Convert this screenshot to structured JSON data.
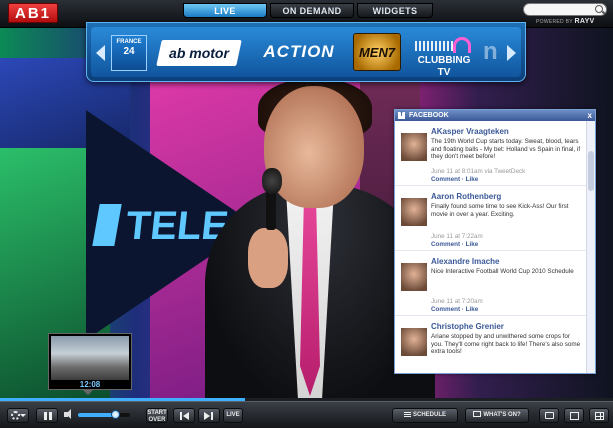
{
  "brand": {
    "logo_text": "AB1",
    "powered_by_prefix": "POWERED BY",
    "powered_by_name": "RAYV"
  },
  "tabs": [
    {
      "label": "LIVE",
      "active": true
    },
    {
      "label": "ON DEMAND",
      "active": false
    },
    {
      "label": "WIDGETS",
      "active": false
    }
  ],
  "search": {
    "placeholder": ""
  },
  "channels": [
    {
      "name": "FRANCE 24",
      "logo_top": "FRANCE",
      "logo_bottom": "24"
    },
    {
      "name": "AB1 MOTOR",
      "logo_text": "ab motor"
    },
    {
      "name": "ACTION",
      "logo_text": "ACTION"
    },
    {
      "name": "MEN7",
      "logo_text": "MEN7"
    },
    {
      "name": "CLUBBING TV",
      "logo_text": "CLUBBING TV"
    },
    {
      "name": "n",
      "logo_text": "n"
    }
  ],
  "video": {
    "channel_overlay_text": "TELE",
    "channel_overlay_number": "i"
  },
  "facebook": {
    "title": "FACEBOOK",
    "close": "x",
    "posts": [
      {
        "author": "AKasper Vraagteken",
        "text": "The 19th World Cup starts today. Sweat, blood, tears and floating balls - My bet: Holland vs Spain in final, if they don't meet before!",
        "time": "June 11 at 8:01am via TweetDeck",
        "actions": "Comment · Like"
      },
      {
        "author": "Aaron Rothenberg",
        "text": "Finally found some time to see Kick-Ass! Our first movie in over a year. Exciting.",
        "time": "June 11 at 7:22am",
        "actions": "Comment · Like"
      },
      {
        "author": "Alexandre Imache",
        "text": "Nice Interactive Football World Cup 2010 Schedule",
        "time": "June 11 at 7:20am",
        "actions": "Comment · Like"
      },
      {
        "author": "Christophe Grenier",
        "text": "Ariane stopped by and unwithered some crops for you. They'll come right back to life! There's also some extra tools!",
        "time": "",
        "actions": ""
      }
    ]
  },
  "preview": {
    "time": "12:08"
  },
  "progress": {
    "fraction": 0.4
  },
  "volume": {
    "fraction": 0.72
  },
  "controls": {
    "start_over": "START\nOVER",
    "live": "LIVE",
    "schedule": "SCHEDULE",
    "whats_on": "WHAT'S ON?"
  },
  "colors": {
    "accent": "#3fb0ff",
    "brand_red": "#d61f1f",
    "facebook_blue": "#3b5998"
  }
}
